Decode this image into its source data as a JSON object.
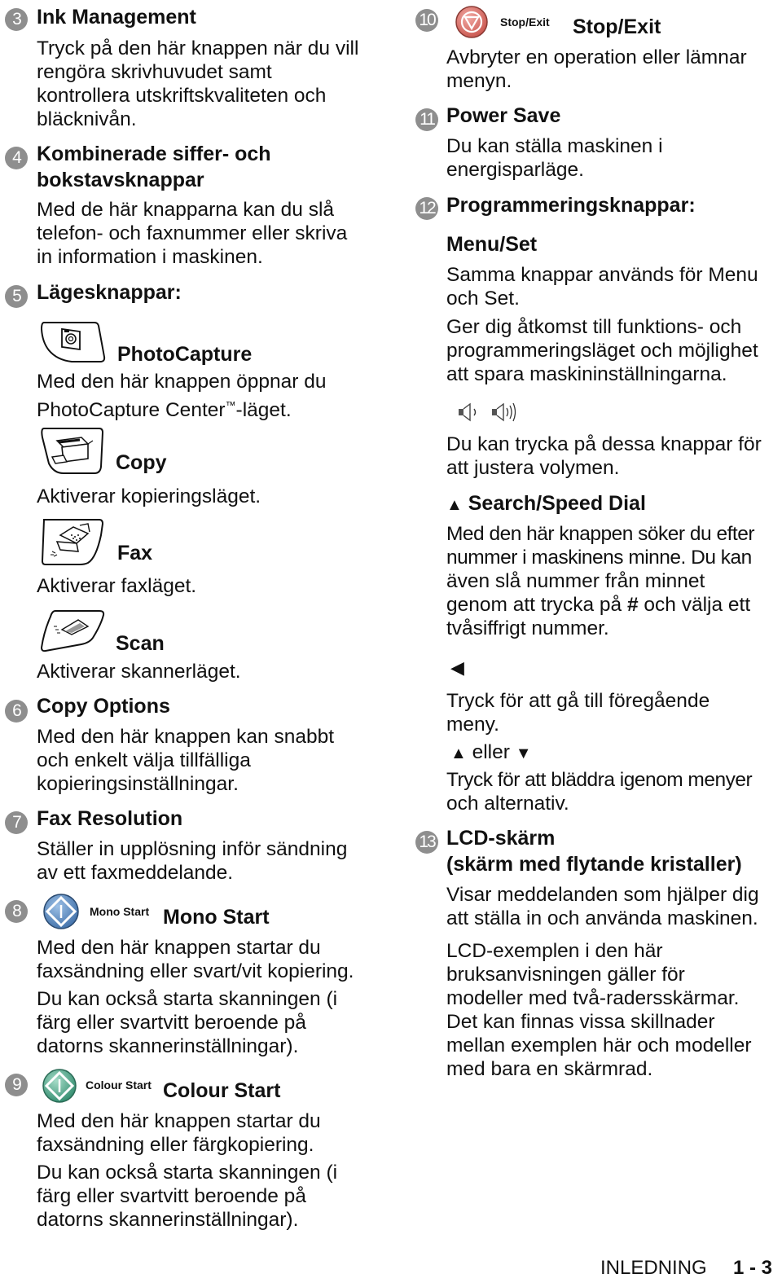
{
  "left": {
    "item3": {
      "number": "3",
      "title": "Ink Management",
      "lines": [
        "Tryck på den här knappen när du vill",
        "rengöra skrivhuvudet samt",
        "kontrollera utskriftskvaliteten och",
        "bläcknivån."
      ]
    },
    "item4": {
      "number": "4",
      "title_lines": [
        "Kombinerade siffer- och",
        "bokstavsknappar"
      ],
      "lines": [
        "Med de här knapparna kan du slå",
        "telefon- och faxnummer eller skriva",
        "in information i maskinen."
      ]
    },
    "item5": {
      "number": "5",
      "title": "Lägesknappar:",
      "modes": [
        {
          "icon": "camera-icon",
          "label": "PhotoCapture",
          "lines": [
            "Med den här knappen öppnar du",
            "PhotoCapture Center"
          ],
          "tm": "™",
          "suffix": "-läget."
        },
        {
          "icon": "copier-icon",
          "label": "Copy",
          "lines": [
            "Aktiverar kopieringsläget."
          ]
        },
        {
          "icon": "fax-machine-icon",
          "label": "Fax",
          "lines": [
            "Aktiverar faxläget."
          ]
        },
        {
          "icon": "scanner-icon",
          "label": "Scan",
          "lines": [
            "Aktiverar skannerläget."
          ]
        }
      ]
    },
    "item6": {
      "number": "6",
      "title": "Copy Options",
      "lines": [
        "Med den här knappen kan snabbt",
        "och enkelt välja tillfälliga",
        "kopieringsinställningar."
      ]
    },
    "item7": {
      "number": "7",
      "title": "Fax Resolution",
      "lines": [
        "Ställer in upplösning inför sändning",
        "av ett faxmeddelande."
      ]
    },
    "item8": {
      "number": "8",
      "key_label": "Mono Start",
      "title": "Mono Start",
      "key_color": "#4d7fb8",
      "lines1": [
        "Med den här knappen startar du",
        "faxsändning eller svart/vit kopiering."
      ],
      "lines2": [
        "Du kan också starta skanningen (i",
        "färg eller svartvitt beroende på",
        "datorns skannerinställningar)."
      ]
    },
    "item9": {
      "number": "9",
      "key_label": "Colour Start",
      "title": "Colour Start",
      "key_color": "#3f9a80",
      "lines1": [
        "Med den här knappen startar du",
        "faxsändning eller färgkopiering."
      ],
      "lines2": [
        "Du kan också starta skanningen (i",
        "färg eller svartvitt beroende på",
        "datorns skannerinställningar)."
      ]
    }
  },
  "right": {
    "item10": {
      "number": "10",
      "key_label": "Stop/Exit",
      "title": "Stop/Exit",
      "key_color": "#d9706a",
      "lines": [
        "Avbryter en operation eller lämnar",
        "menyn."
      ]
    },
    "item11": {
      "number": "11",
      "title": "Power Save",
      "lines": [
        "Du kan ställa maskinen i",
        "energisparläge."
      ]
    },
    "item12": {
      "number": "12",
      "title": "Programmeringsknappar:",
      "menu_set": {
        "title": "Menu/Set",
        "lines1": [
          "Samma knappar används för Menu",
          "och Set."
        ],
        "lines2": [
          "Ger dig åtkomst till funktions- och",
          "programmeringsläget och möjlighet",
          "att spara maskininställningarna."
        ]
      },
      "volume": {
        "icons": [
          "volume-low-icon",
          "volume-high-icon"
        ],
        "lines": [
          "Du kan trycka på dessa knappar för",
          "att justera volymen."
        ]
      },
      "search": {
        "arrow": "▲",
        "title": "Search/Speed Dial",
        "lines": [
          "Med den här knappen söker du efter",
          "nummer i maskinens minne. Du kan",
          "även slå nummer från minnet"
        ],
        "line4_pre": "genom att trycka på ",
        "line4_bold": "#",
        "line4_post": " och välja ett",
        "line5": "tvåsiffrigt nummer."
      },
      "back": {
        "arrow": "◀",
        "lines": [
          "Tryck för att gå till föregående",
          "meny."
        ]
      },
      "updown": {
        "up": "▲",
        "text": "eller",
        "down": "▼",
        "lines": [
          "Tryck för att bläddra igenom menyer",
          "och alternativ."
        ]
      }
    },
    "item13": {
      "number": "13",
      "title_lines": [
        "LCD-skärm",
        "(skärm med flytande kristaller)"
      ],
      "lines1": [
        "Visar meddelanden som hjälper dig",
        "att ställa in och använda maskinen."
      ],
      "lines2": [
        "LCD-exemplen i den här",
        "bruksanvisningen gäller för",
        "modeller med två-radersskärmar.",
        "Det kan finnas vissa skillnader",
        "mellan exemplen här och modeller",
        "med bara en skärmrad."
      ]
    }
  },
  "footer": {
    "section": "INLEDNING",
    "page": "1 - 3"
  }
}
